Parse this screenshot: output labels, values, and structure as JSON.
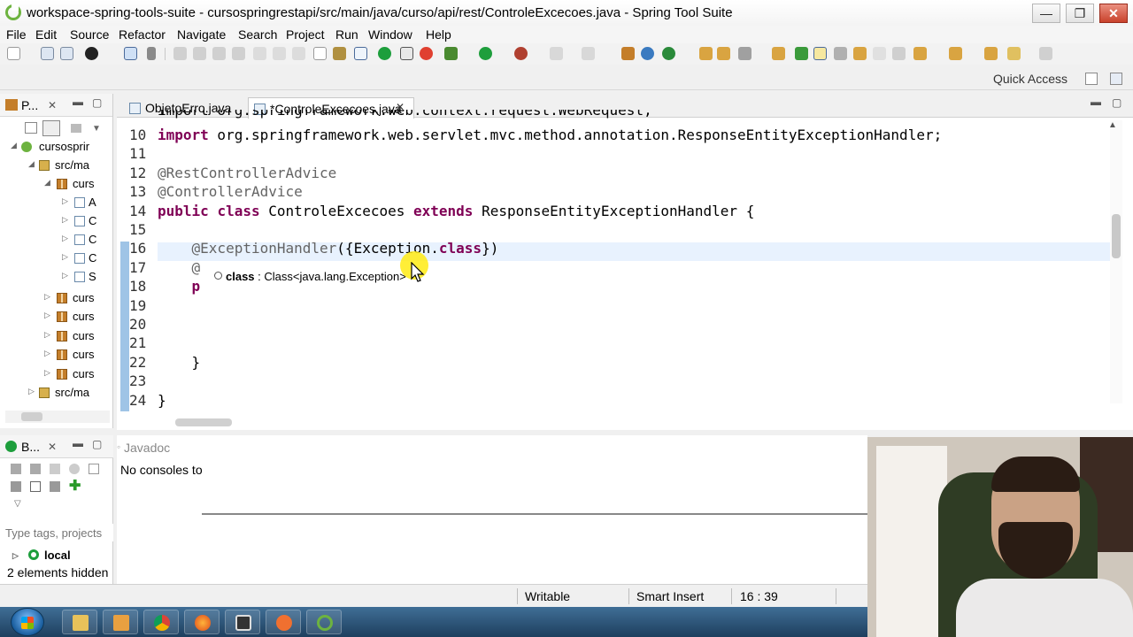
{
  "window": {
    "title": "workspace-spring-tools-suite - cursospringrestapi/src/main/java/curso/api/rest/ControleExcecoes.java - Spring Tool Suite",
    "minimize": "—",
    "maximize": "❐",
    "close": "✕"
  },
  "menu": [
    "File",
    "Edit",
    "Source",
    "Refactor",
    "Navigate",
    "Search",
    "Project",
    "Run",
    "Window",
    "Help"
  ],
  "quick_access": "Quick Access",
  "package_explorer": {
    "tab_label": "P...",
    "items": [
      {
        "label": "cursosprir",
        "icon": "project-icon"
      },
      {
        "label": "src/ma",
        "icon": "source-folder-icon"
      },
      {
        "label": "curs",
        "icon": "package-icon"
      },
      {
        "label": "A",
        "icon": "java-file-icon"
      },
      {
        "label": "C",
        "icon": "java-file-icon"
      },
      {
        "label": "C",
        "icon": "java-file-icon"
      },
      {
        "label": "C",
        "icon": "java-file-icon"
      },
      {
        "label": "S",
        "icon": "java-file-icon"
      },
      {
        "label": "curs",
        "icon": "package-icon"
      },
      {
        "label": "curs",
        "icon": "package-icon"
      },
      {
        "label": "curs",
        "icon": "package-icon"
      },
      {
        "label": "curs",
        "icon": "package-icon"
      },
      {
        "label": "curs",
        "icon": "package-icon"
      },
      {
        "label": "src/ma",
        "icon": "source-folder-icon"
      }
    ]
  },
  "editor": {
    "tabs": [
      {
        "label": "ObjetoErro.java",
        "active": false
      },
      {
        "label": "*ControleExcecoes.java",
        "active": true
      }
    ],
    "partial_line": "import org.springframework.web.context.request.WebRequest;",
    "lines": [
      {
        "num": "10",
        "tokens": [
          {
            "t": "import",
            "s": "kw"
          },
          {
            "t": " org.springframework.web.servlet.mvc.method.annotation.ResponseEntityExceptionHandler;",
            "s": "cls"
          }
        ]
      },
      {
        "num": "11",
        "tokens": []
      },
      {
        "num": "12",
        "tokens": [
          {
            "t": "@RestControllerAdvice",
            "s": "ann"
          }
        ]
      },
      {
        "num": "13",
        "tokens": [
          {
            "t": "@ControllerAdvice",
            "s": "ann"
          }
        ]
      },
      {
        "num": "14",
        "tokens": [
          {
            "t": "public",
            "s": "kw"
          },
          {
            "t": " ",
            "s": "cls"
          },
          {
            "t": "class",
            "s": "kw"
          },
          {
            "t": " ControleExcecoes ",
            "s": "cls"
          },
          {
            "t": "extends",
            "s": "kw"
          },
          {
            "t": " ResponseEntityExceptionHandler {",
            "s": "cls"
          }
        ]
      },
      {
        "num": "15",
        "tokens": []
      },
      {
        "num": "16",
        "tokens": [
          {
            "t": "    @ExceptionHandler",
            "s": "ann"
          },
          {
            "t": "({Exception.",
            "s": "cls"
          },
          {
            "t": "class",
            "s": "kw"
          },
          {
            "t": "})",
            "s": "cls"
          }
        ]
      },
      {
        "num": "17",
        "tokens": [
          {
            "t": "    @",
            "s": "ann"
          }
        ]
      },
      {
        "num": "18",
        "tokens": [
          {
            "t": "    p",
            "s": "kw"
          }
        ]
      },
      {
        "num": "19",
        "tokens": []
      },
      {
        "num": "20",
        "tokens": []
      },
      {
        "num": "21",
        "tokens": []
      },
      {
        "num": "22",
        "tokens": [
          {
            "t": "    }",
            "s": "cls"
          }
        ]
      },
      {
        "num": "23",
        "tokens": []
      },
      {
        "num": "24",
        "tokens": [
          {
            "t": "}",
            "s": "cls"
          }
        ]
      }
    ],
    "content_assist": {
      "name": "class",
      "type": " : Class<java.lang.Exception>"
    }
  },
  "boot_dashboard": {
    "tab_label": "B...",
    "filter_placeholder": "Type tags, projects",
    "local_label": "local",
    "hidden_text": "2 elements hidden"
  },
  "console": {
    "tab_label": "Javadoc",
    "message": "No consoles to"
  },
  "status": {
    "writable": "Writable",
    "insert_mode": "Smart Insert",
    "position": "16 : 39"
  },
  "colors": {
    "keyword": "#7f0055",
    "annotation": "#646464",
    "current_line": "#e8f2fe",
    "spring_green": "#6db33f"
  }
}
